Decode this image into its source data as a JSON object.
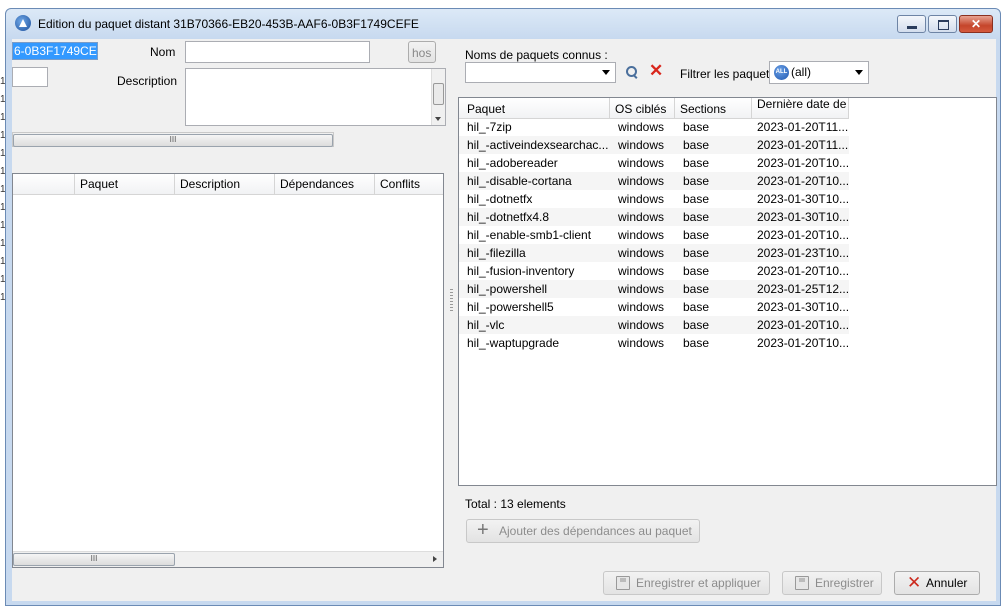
{
  "window": {
    "title": "Edition du paquet distant 31B70366-EB20-453B-AAF6-0B3F1749CEFE"
  },
  "form": {
    "id_value": "6-0B3F1749CEFE",
    "nom_label": "Nom",
    "description_label": "Description",
    "hos_label": "hos"
  },
  "left_grid": {
    "columns": [
      "Paquet",
      "Description",
      "Dépendances",
      "Conflits"
    ]
  },
  "right": {
    "known_packages_label": "Noms de paquets connus :",
    "filter_label": "Filtrer les paquets",
    "filter_value": "(all)",
    "filter_badge": "ALL",
    "columns": [
      "Paquet",
      "OS ciblés",
      "Sections",
      "Dernière date de"
    ],
    "rows": [
      {
        "paquet": "hil_-7zip",
        "os": "windows",
        "section": "base",
        "date": "2023-01-20T11..."
      },
      {
        "paquet": "hil_-activeindexsearchac...",
        "os": "windows",
        "section": "base",
        "date": "2023-01-20T11..."
      },
      {
        "paquet": "hil_-adobereader",
        "os": "windows",
        "section": "base",
        "date": "2023-01-20T10..."
      },
      {
        "paquet": "hil_-disable-cortana",
        "os": "windows",
        "section": "base",
        "date": "2023-01-20T10..."
      },
      {
        "paquet": "hil_-dotnetfx",
        "os": "windows",
        "section": "base",
        "date": "2023-01-30T10..."
      },
      {
        "paquet": "hil_-dotnetfx4.8",
        "os": "windows",
        "section": "base",
        "date": "2023-01-30T10..."
      },
      {
        "paquet": "hil_-enable-smb1-client",
        "os": "windows",
        "section": "base",
        "date": "2023-01-20T10..."
      },
      {
        "paquet": "hil_-filezilla",
        "os": "windows",
        "section": "base",
        "date": "2023-01-23T10..."
      },
      {
        "paquet": "hil_-fusion-inventory",
        "os": "windows",
        "section": "base",
        "date": "2023-01-20T10..."
      },
      {
        "paquet": "hil_-powershell",
        "os": "windows",
        "section": "base",
        "date": "2023-01-25T12..."
      },
      {
        "paquet": "hil_-powershell5",
        "os": "windows",
        "section": "base",
        "date": "2023-01-30T10..."
      },
      {
        "paquet": "hil_-vlc",
        "os": "windows",
        "section": "base",
        "date": "2023-01-20T10..."
      },
      {
        "paquet": "hil_-waptupgrade",
        "os": "windows",
        "section": "base",
        "date": "2023-01-20T10..."
      }
    ],
    "total": "Total : 13 elements",
    "add_deps_label": "Ajouter des dépendances au paquet"
  },
  "footer": {
    "save_apply_label": "Enregistrer et appliquer",
    "save_label": "Enregistrer",
    "cancel_label": "Annuler"
  },
  "background": {
    "edge_glyphs": [
      "1",
      "1",
      "1",
      "1",
      "1",
      "1",
      "1",
      "1",
      "1",
      "1",
      "1",
      "1",
      "1"
    ]
  },
  "colors": {
    "selection": "#3399ff",
    "close_red": "#c5452b",
    "clear_red": "#d9261c"
  }
}
